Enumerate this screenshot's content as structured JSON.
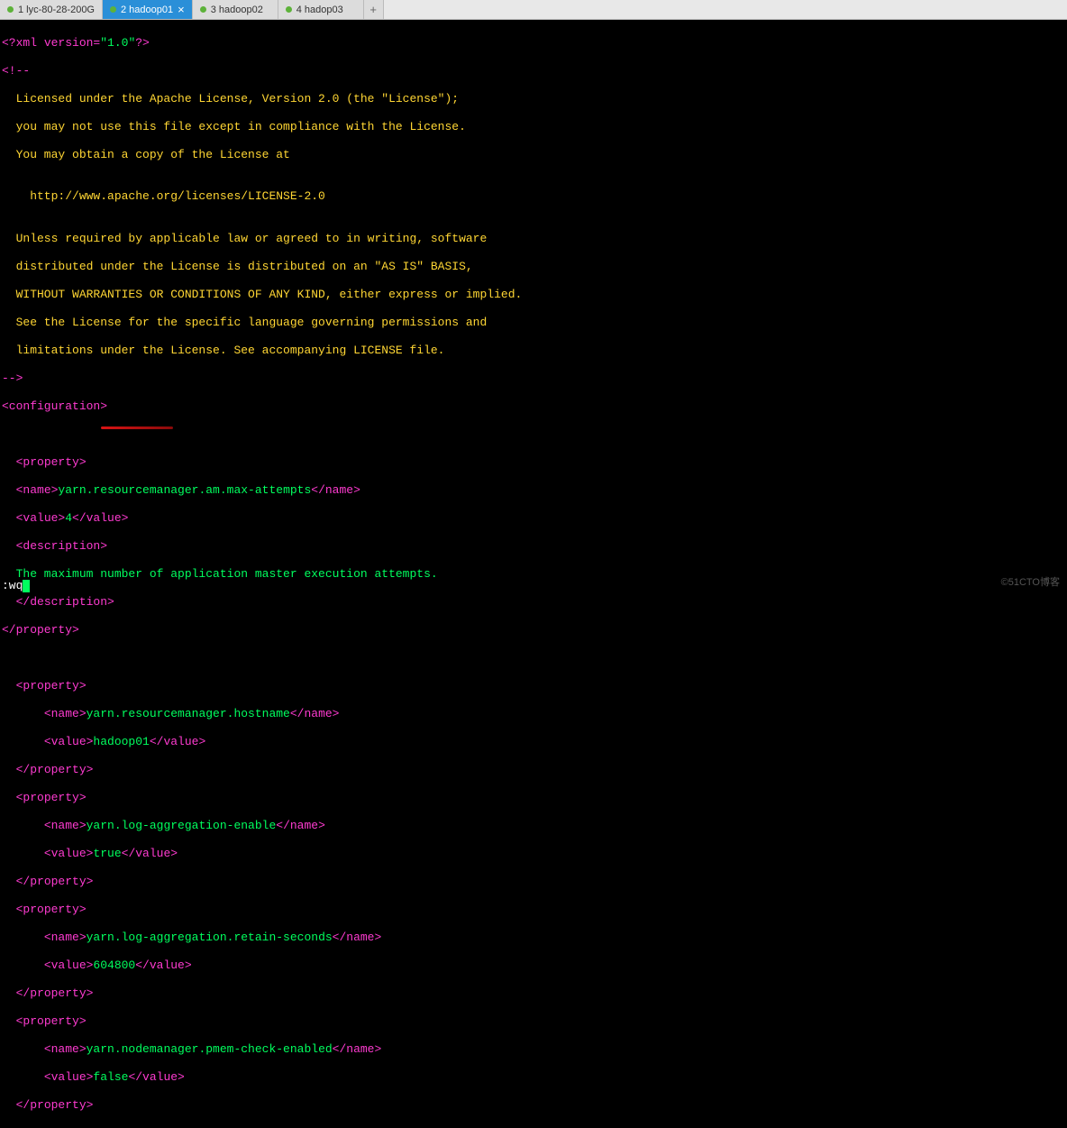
{
  "tabs": [
    {
      "label": "1 lyc-80-28-200G",
      "active": false
    },
    {
      "label": "2 hadoop01",
      "active": true
    },
    {
      "label": "3 hadoop02",
      "active": false
    },
    {
      "label": "4 hadop03",
      "active": false
    }
  ],
  "xml": {
    "declaration": {
      "open": "<?xml ",
      "attr": "version=",
      "val": "\"1.0\"",
      "close": "?>"
    },
    "comment_open": "<!--",
    "license": [
      "  Licensed under the Apache License, Version 2.0 (the \"License\");",
      "  you may not use this file except in compliance with the License.",
      "  You may obtain a copy of the License at",
      "",
      "    http://www.apache.org/licenses/LICENSE-2.0",
      "",
      "  Unless required by applicable law or agreed to in writing, software",
      "  distributed under the License is distributed on an \"AS IS\" BASIS,",
      "  WITHOUT WARRANTIES OR CONDITIONS OF ANY KIND, either express or implied.",
      "  See the License for the specific language governing permissions and",
      "  limitations under the License. See accompanying LICENSE file."
    ],
    "comment_close": "-->",
    "config_open": "<configuration>",
    "prop_open": "<property>",
    "prop_close": "</property>",
    "name_open": "<name>",
    "name_close": "</name>",
    "value_open": "<value>",
    "value_close": "</value>",
    "desc_open": "<description>",
    "desc_close": "</description>",
    "props": {
      "p1": {
        "name": "yarn.resourcemanager.am.max-attempts",
        "value": "4",
        "desc": "  The maximum number of application master execution attempts."
      },
      "p2": {
        "name": "yarn.resourcemanager.hostname",
        "value": "hadoop01"
      },
      "p3": {
        "name": "yarn.log-aggregation-enable",
        "value": "true"
      },
      "p4": {
        "name": "yarn.log-aggregation.retain-seconds",
        "value": "604800"
      },
      "p5": {
        "name": "yarn.nodemanager.pmem-check-enabled",
        "value": "false"
      }
    }
  },
  "status": ":wq",
  "watermark": "©51CTO博客"
}
